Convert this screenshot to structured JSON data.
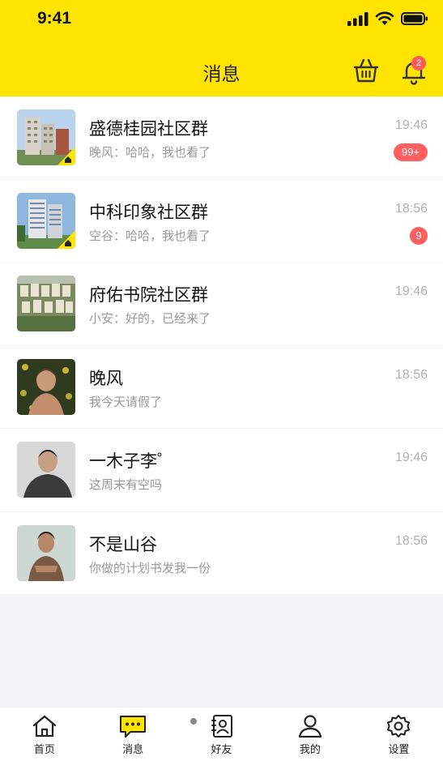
{
  "status_bar": {
    "time": "9:41"
  },
  "header": {
    "title": "消息",
    "notification_count": "2",
    "background": "#ffe400"
  },
  "colors": {
    "accent": "#ffe400",
    "badge": "#ff5f5f"
  },
  "conversations": [
    {
      "name": "盛德桂园社区群",
      "preview": "晚风：哈哈，我也看了",
      "time": "19:46",
      "badge": "99+",
      "avatar": "building-group-avatar"
    },
    {
      "name": "中科印象社区群",
      "preview": "空谷：哈哈，我也看了",
      "time": "18:56",
      "badge": "9",
      "avatar": "building-group-avatar"
    },
    {
      "name": "府佑书院社区群",
      "preview": "小安：好的，已经来了",
      "time": "19:46",
      "badge": "",
      "avatar": "aerial-community-avatar"
    },
    {
      "name": "晚风",
      "preview": "我今天请假了",
      "time": "18:56",
      "badge": "",
      "avatar": "person-avatar"
    },
    {
      "name": "一木子李゜",
      "preview": "这周末有空吗",
      "time": "19:46",
      "badge": "",
      "avatar": "person-avatar"
    },
    {
      "name": "不是山谷",
      "preview": "你做的计划书发我一份",
      "time": "18:56",
      "badge": "",
      "avatar": "person-avatar"
    }
  ],
  "tabbar": {
    "items": [
      {
        "label": "首页",
        "icon": "home-icon",
        "active": false
      },
      {
        "label": "消息",
        "icon": "message-icon",
        "active": true
      },
      {
        "label": "好友",
        "icon": "contacts-icon",
        "active": false
      },
      {
        "label": "我的",
        "icon": "person-icon",
        "active": false
      },
      {
        "label": "设置",
        "icon": "gear-icon",
        "active": false
      }
    ]
  }
}
